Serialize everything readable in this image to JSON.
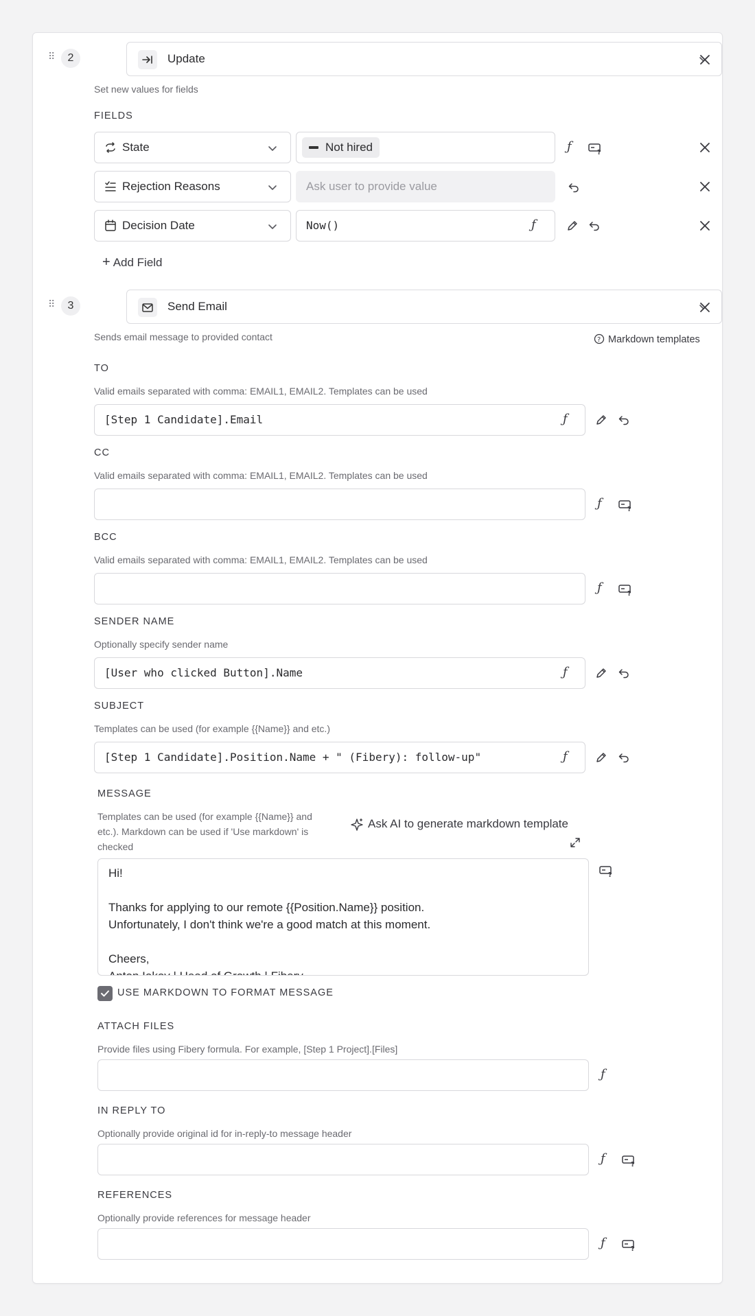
{
  "step2": {
    "number": "2",
    "action": "Update",
    "icon": "arrow-right-to-bar-icon",
    "description": "Set new values for fields",
    "fields_label": "FIELDS",
    "fields": [
      {
        "name": "State",
        "icon": "cycle-icon",
        "value_chip": "Not hired"
      },
      {
        "name": "Rejection Reasons",
        "icon": "multi-select-icon",
        "placeholder": "Ask user to provide value"
      },
      {
        "name": "Decision Date",
        "icon": "calendar-icon",
        "value": "Now()"
      }
    ],
    "add_field": "Add Field"
  },
  "step3": {
    "number": "3",
    "action": "Send Email",
    "icon": "mail-icon",
    "description": "Sends email message to provided contact",
    "markdown_templates": "Markdown templates",
    "to": {
      "label": "TO",
      "hint": "Valid emails separated with comma: EMAIL1, EMAIL2. Templates can be used",
      "value": "[Step 1 Candidate].Email"
    },
    "cc": {
      "label": "CC",
      "hint": "Valid emails separated with comma: EMAIL1, EMAIL2. Templates can be used",
      "value": ""
    },
    "bcc": {
      "label": "BCC",
      "hint": "Valid emails separated with comma: EMAIL1, EMAIL2. Templates can be used",
      "value": ""
    },
    "sender": {
      "label": "SENDER NAME",
      "hint": "Optionally specify sender name",
      "value": "[User who clicked Button].Name"
    },
    "subject": {
      "label": "SUBJECT",
      "hint": "Templates can be used (for example {{Name}} and etc.)",
      "value": "[Step 1 Candidate].Position.Name + \" (Fibery): follow-up\""
    },
    "message": {
      "label": "MESSAGE",
      "hint_lines": [
        "Templates can be used (for example {{Name}} and",
        "etc.). Markdown can be used if 'Use markdown' is",
        "checked"
      ],
      "ai_button": "Ask AI to generate markdown template",
      "lines": [
        "Hi!",
        "",
        "Thanks for applying to our remote {{Position.Name}} position.",
        "Unfortunately, I don't think we're a good match at this moment.",
        "",
        "Cheers,",
        "Anton Iokov | Head of Growth | Fibery"
      ]
    },
    "use_markdown": {
      "label": "USE MARKDOWN TO FORMAT MESSAGE",
      "checked": true
    },
    "attach": {
      "label": "ATTACH FILES",
      "hint": "Provide files using Fibery formula. For example, [Step 1 Project].[Files]",
      "value": ""
    },
    "reply": {
      "label": "IN REPLY TO",
      "hint": "Optionally provide original id for in-reply-to message header",
      "value": ""
    },
    "references": {
      "label": "REFERENCES",
      "hint": "Optionally provide references for message header",
      "value": ""
    }
  }
}
